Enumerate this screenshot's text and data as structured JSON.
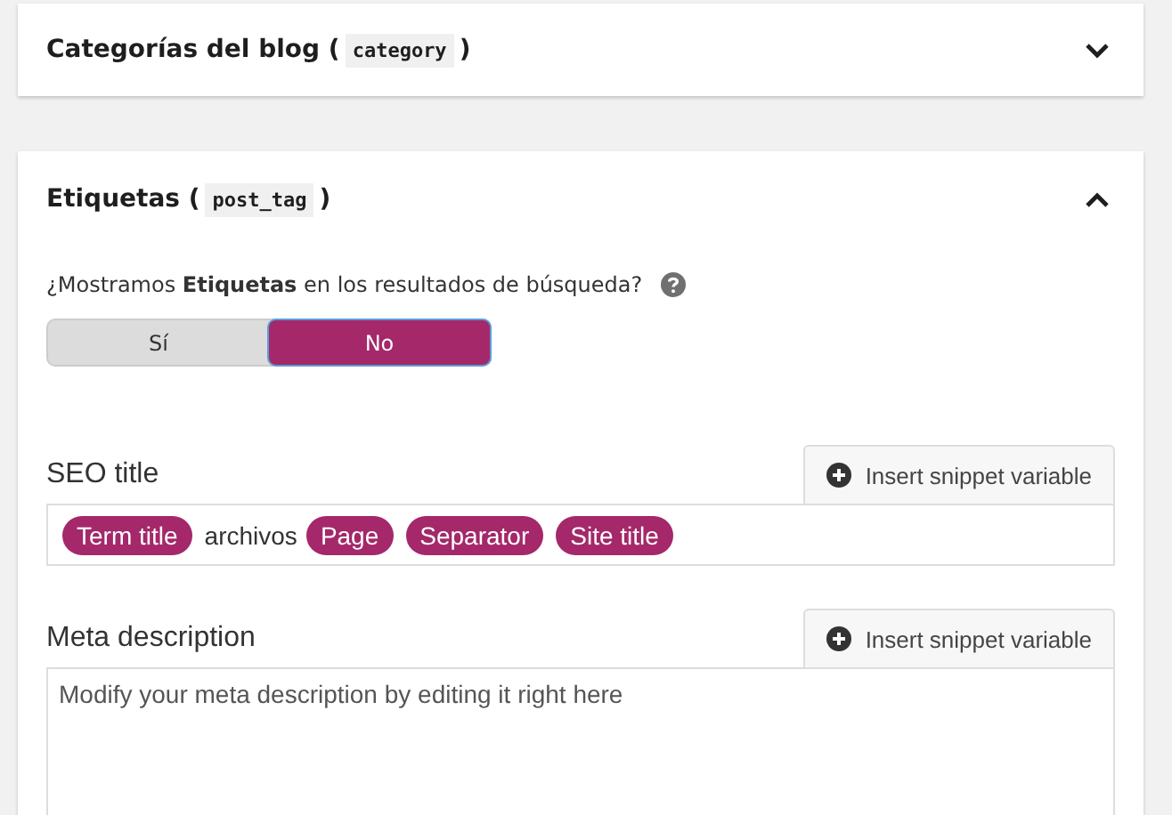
{
  "panels": [
    {
      "title": "Categorías del blog (",
      "code": "category",
      "close": ")",
      "expanded": false
    },
    {
      "title": "Etiquetas (",
      "code": "post_tag",
      "close": ")",
      "expanded": true,
      "question": "¿Mostramos **Etiquetas** en los resultados de búsqueda?",
      "toggle": [
        {
          "label": "Sí",
          "selected": false
        },
        {
          "label": "No",
          "selected": true
        }
      ],
      "seo_title": {
        "label": "SEO title",
        "button": "Insert snippet variable",
        "parts": [
          {
            "kind": "variable",
            "text": "Term title"
          },
          {
            "kind": "text",
            "text": "archivos"
          },
          {
            "kind": "variable",
            "text": "Page"
          },
          {
            "kind": "variable",
            "text": "Separator"
          },
          {
            "kind": "variable",
            "text": "Site title"
          }
        ]
      },
      "meta_description": {
        "label": "Meta description",
        "button": "Insert snippet variable",
        "placeholder": "Modify your meta description by editing it right here"
      }
    }
  ]
}
